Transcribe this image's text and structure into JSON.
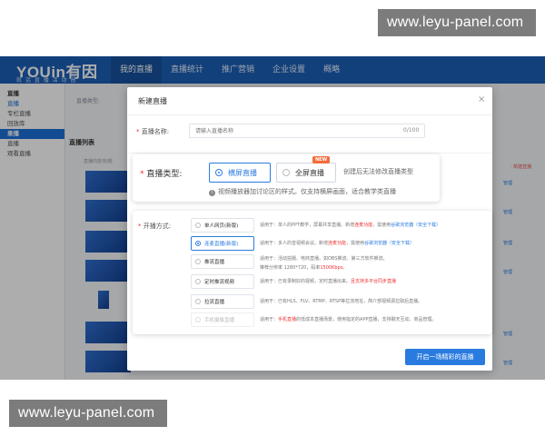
{
  "watermarks": {
    "top": "www.leyu-panel.com",
    "bottom": "www.leyu-panel.com"
  },
  "brand": {
    "logo": "YOUin有因",
    "tagline": "就 话 直 播 活 动 圈"
  },
  "nav": [
    "我的直播",
    "直播统计",
    "推广营销",
    "企业设置",
    "概略"
  ],
  "sidebar": [
    "直播",
    "直播",
    "专栏直播",
    "回放库",
    "录播",
    "直播",
    "观看直播"
  ],
  "background": {
    "crumb": "直播类型:",
    "list_title": "直播列表",
    "col_head": "直播内容/标题",
    "op_label": "管理",
    "top_op": "·  新建直播"
  },
  "modal": {
    "title": "新建直播",
    "close": "×",
    "name_label": "直播名称:",
    "name_placeholder": "请输入直播名称",
    "name_counter": "0/100"
  },
  "live_type": {
    "label": "直播类型:",
    "options": [
      "横屏直播",
      "全屏直播"
    ],
    "badge": "NEW",
    "note": "创建后无法修改直播类型",
    "tip": "视频播放器加讨论区的样式。仅支持横屏画面，适合教学类直播"
  },
  "live_mode": {
    "label": "开播方式:",
    "options": [
      {
        "name": "单人网页(新版)",
        "desc_a": "适用于：单人的PPT教学，屏幕共享直播。新增",
        "desc_hl": "连麦功能",
        "desc_b": "，需使用",
        "desc_link": "谷歌浏览器（安全下载）"
      },
      {
        "name": "连麦直播(新版)",
        "desc_a": "适用于：多人的音视频会议。新增",
        "desc_hl": "连麦功能",
        "desc_b": "，需使用",
        "desc_link": "谷歌浏览器（安全下载）"
      },
      {
        "name": "推流直播",
        "desc_a": "适用于：活动拍摄、电商直播。如OBS推流、第三方软件推流。",
        "desc_line2_a": "推荐分辨率 1280*720，码率",
        "desc_line2_hl": "1500Kbps。"
      },
      {
        "name": "定时推流视频",
        "desc_a": "适用于：已有录制好的视频，定时直播出来。",
        "desc_hl": "且支持多平台同步直播"
      },
      {
        "name": "拉流直播",
        "desc_a": "适用于：已有HLS、FLV、RTMP、RTSP等拉流地址，简介部视频源拉取后直播。"
      },
      {
        "name": "手机摄像直播",
        "desc_a": "适用于：",
        "desc_hl": "手机直播",
        "desc_b": "的低成本直播场景，使用指定的APP直播，支持聊天互动、商品管理。"
      }
    ]
  },
  "submit": "开启一场精彩的直播"
}
